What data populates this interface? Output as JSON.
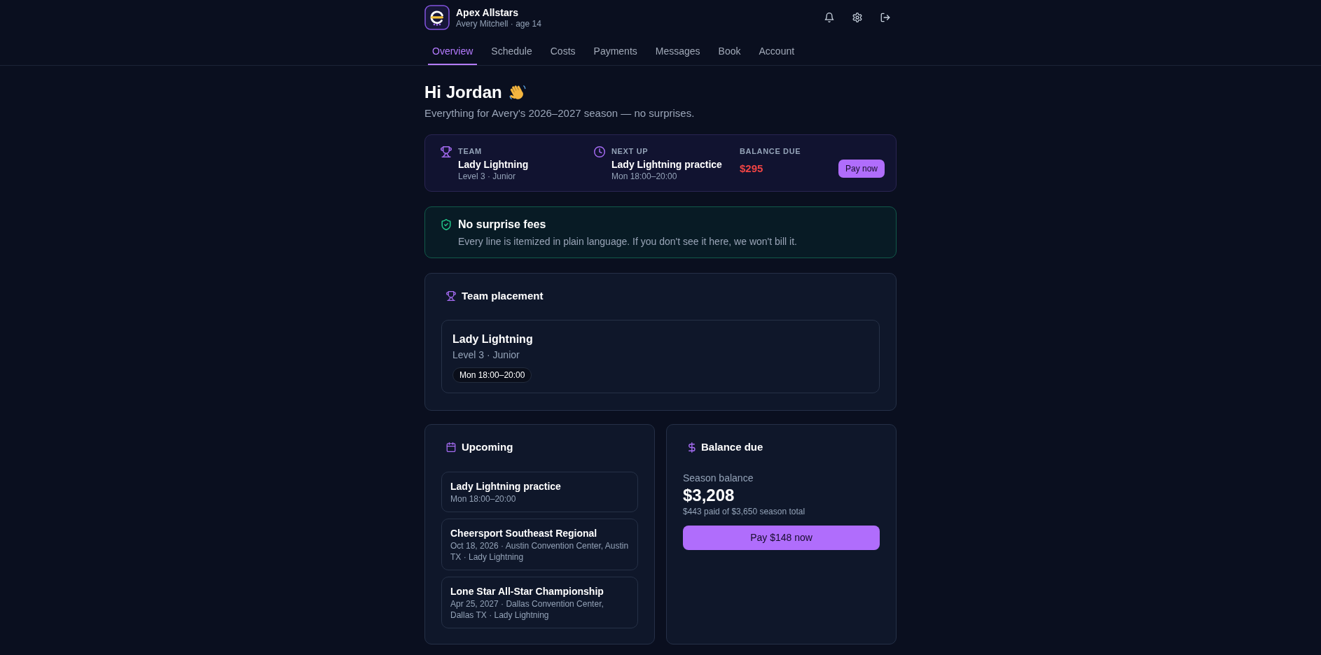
{
  "header": {
    "app_name": "Apex Allstars",
    "subtitle": "Avery Mitchell · age 14"
  },
  "tabs": [
    {
      "label": "Overview",
      "selected": true
    },
    {
      "label": "Schedule",
      "selected": false
    },
    {
      "label": "Costs",
      "selected": false
    },
    {
      "label": "Payments",
      "selected": false
    },
    {
      "label": "Messages",
      "selected": false
    },
    {
      "label": "Book",
      "selected": false
    },
    {
      "label": "Account",
      "selected": false
    }
  ],
  "greeting": {
    "title": "Hi Jordan",
    "subtitle": "Everything for Avery's 2026–2027 season — no surprises."
  },
  "summary": [
    {
      "kind": "team",
      "label": "TEAM",
      "name": "Lady Lightning",
      "detail": "Level 3 · Junior"
    },
    {
      "kind": "next_up",
      "label": "NEXT UP",
      "name": "Lady Lightning practice",
      "detail": "Mon 18:00–20:00"
    },
    {
      "kind": "balance",
      "label": "BALANCE DUE",
      "amount": "$295",
      "button": "Pay now"
    }
  ],
  "notice": {
    "title": "No surprise fees",
    "text": "Every line is itemized in plain language. If you don't see it here, we won't bill it."
  },
  "team_placement": {
    "title": "Team placement",
    "team": {
      "name": "Lady Lightning",
      "detail": "Level 3 · Junior",
      "schedule": "Mon 18:00–20:00"
    }
  },
  "upcoming": {
    "title": "Upcoming",
    "events": [
      {
        "title": "Lady Lightning practice",
        "detail": "Mon 18:00–20:00"
      },
      {
        "title": "Cheersport Southeast Regional",
        "detail": "Oct 18, 2026 · Austin Convention Center, Austin TX · Lady Lightning"
      },
      {
        "title": "Lone Star All-Star Championship",
        "detail": "Apr 25, 2027 · Dallas Convention Center, Dallas TX · Lady Lightning"
      }
    ]
  },
  "balance_due": {
    "title": "Balance due",
    "label": "Season balance",
    "amount": "$3,208",
    "note": "$443 paid of $3,650 season total",
    "button": "Pay $148 now"
  }
}
